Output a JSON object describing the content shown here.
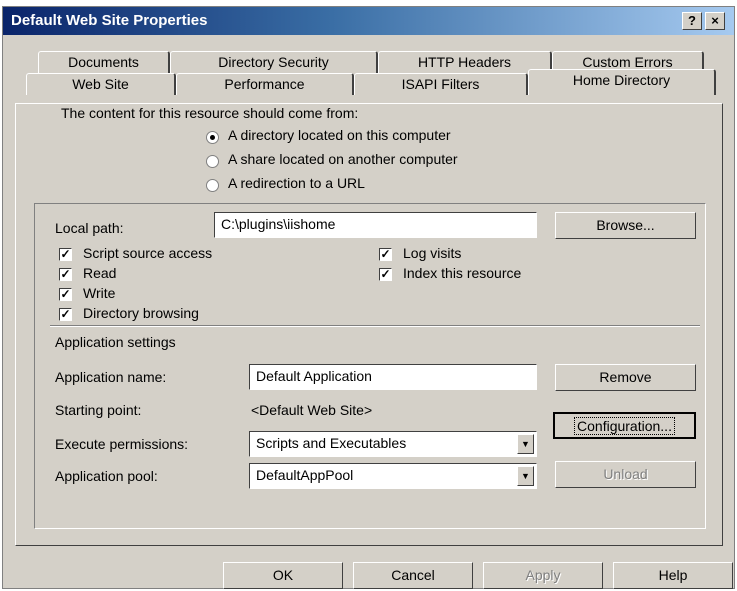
{
  "window": {
    "title": "Default Web Site Properties",
    "help_icon": "?",
    "close_icon": "×"
  },
  "tabs_row1": [
    "Documents",
    "Directory Security",
    "HTTP Headers",
    "Custom Errors"
  ],
  "tabs_row2": [
    "Web Site",
    "Performance",
    "ISAPI Filters",
    "Home Directory"
  ],
  "content_source": {
    "label": "The content for this resource should come from:",
    "options": [
      "A directory located on this computer",
      "A share located on another computer",
      "A redirection to a URL"
    ],
    "selected_index": 0
  },
  "local_path": {
    "label": "Local path:",
    "value": "C:\\plugins\\iishome",
    "browse_label": "Browse..."
  },
  "permissions": {
    "script_source_access": "Script source access",
    "read": "Read",
    "write": "Write",
    "directory_browsing": "Directory browsing",
    "log_visits": "Log visits",
    "index_this_resource": "Index this resource",
    "all_checked": true
  },
  "app_settings": {
    "heading": "Application settings",
    "name_label": "Application name:",
    "name_value": "Default Application",
    "remove_label": "Remove",
    "starting_point_label": "Starting point:",
    "starting_point_value": "<Default Web Site>",
    "configuration_label": "Configuration...",
    "exec_perm_label": "Execute permissions:",
    "exec_perm_value": "Scripts and Executables",
    "app_pool_label": "Application pool:",
    "app_pool_value": "DefaultAppPool",
    "unload_label": "Unload"
  },
  "footer": {
    "ok": "OK",
    "cancel": "Cancel",
    "apply": "Apply",
    "help": "Help"
  }
}
